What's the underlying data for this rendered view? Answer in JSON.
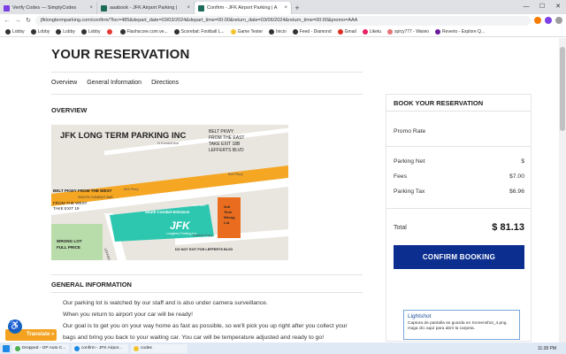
{
  "browser": {
    "tabs": [
      {
        "label": "Verify Codes — SimplyCodes",
        "color": "#7b3fe4",
        "active": false
      },
      {
        "label": "aaabook - JFK Airport Parking |",
        "color": "#1f6b5a",
        "active": false
      },
      {
        "label": "Confirm - JFK Airport Parking | A",
        "color": "#1f6b5a",
        "active": true
      }
    ],
    "new_tab": "+",
    "url": "jfklongtermparking.com/confirm/?loc=485&depart_date=03/03/2024&depart_time=00:00&return_date=03/06/2024&return_time=00:00&promo=AAA",
    "bookmarks": [
      {
        "label": "Lobby",
        "color": "#333"
      },
      {
        "label": "Lobby",
        "color": "#333"
      },
      {
        "label": "Lobby",
        "color": "#333"
      },
      {
        "label": "Lobby",
        "color": "#333"
      },
      {
        "label": "",
        "color": "#e53935"
      },
      {
        "label": "Flashscore.com.ve...",
        "color": "#333"
      },
      {
        "label": "Scorebat: Football L...",
        "color": "#333"
      },
      {
        "label": "Game Tester",
        "color": "#f4c430"
      },
      {
        "label": "Inicio",
        "color": "#333"
      },
      {
        "label": "Feed - Diamond",
        "color": "#333"
      },
      {
        "label": "Gmail",
        "color": "#d93025"
      },
      {
        "label": "Liketu",
        "color": "#e91e63"
      },
      {
        "label": "spicy777 - Waivio",
        "color": "#e57373"
      },
      {
        "label": "Reverio - Explore Q...",
        "color": "#6a1b9a"
      }
    ]
  },
  "page": {
    "title": "YOUR RESERVATION",
    "subnav": [
      "Overview",
      "General Information",
      "Directions"
    ],
    "overview_heading": "OVERVIEW",
    "general_heading": "GENERAL INFORMATION",
    "general_lines": [
      "Our parking lot is watched by our staff and is also under camera surveillance.",
      "When you return to airport your car will be ready!",
      "Our goal is to get you on your way home as fast as possible, so we'll pick you up right after you collect your",
      "bags and bring you back to your waiting car. You car will be temperature adjusted and ready to go!"
    ]
  },
  "map": {
    "title": "JFK LONG TERM PARKING INC",
    "note_lines": [
      "BELT PKWY",
      "FROM THE EAST",
      "TAKE EXIT 18B",
      "LEFFERTS BLVD"
    ],
    "belt_west": "BELT PKWY  FROM THE WEST",
    "west_note_lines": [
      "FROM THE WEST",
      "TAKE EXIT 19"
    ],
    "wrong_lot_lines": [
      "WRONG LOT",
      "FULL PRICE"
    ],
    "south_conduit": "SOUTH CONDUIT AVE",
    "conduit_ave": "N Conduit Ave",
    "belt_pkwy": "Belt Pkwy",
    "entrance": "South Conduit Entrance",
    "logo_main": "JFK",
    "logo_sub": "Longterm Parking Inc.",
    "second_lot_lines": [
      "2nd",
      "Term",
      "Wrong",
      "Lot"
    ],
    "street_label": "DO NOT EXIT FOR LEFFERTS BLVD",
    "nassau": "Nassau Expy",
    "lefferts": "LEFFERTS BLVD",
    "go_here": "GO Here",
    "colors": {
      "land": "#e9e6df",
      "road_orange": "#f5a623",
      "lot_teal": "#2dc7b0",
      "wrong_lot": "#ea6d1f",
      "green": "#b8dcaa"
    }
  },
  "booking": {
    "heading": "BOOK YOUR RESERVATION",
    "promo_label": "Promo Rate",
    "rows": [
      {
        "label": "Parking Net",
        "value": "$"
      },
      {
        "label": "Fees",
        "value": "$7.00"
      },
      {
        "label": "Parking Tax",
        "value": "$6.96"
      }
    ],
    "total_label": "Total",
    "total_value": "$ 81.13",
    "confirm_label": "CONFIRM BOOKING",
    "confirm_color": "#0b2e8f"
  },
  "overlays": {
    "translate": "Translate »",
    "lightshot_title": "Lightshot",
    "lightshot_text": "Captura de pantalla se guarda en Screenshot_4.png. Haga clic aquí para abrir la carpeta."
  },
  "taskbar": {
    "items": [
      {
        "label": "Dropped - OP Auto C...",
        "color": "#4caf50"
      },
      {
        "label": "confirm - JFK Airpor...",
        "color": "#1e88e5"
      },
      {
        "label": "codes",
        "color": "#f4c430"
      }
    ],
    "clock": "11:38 PM"
  }
}
